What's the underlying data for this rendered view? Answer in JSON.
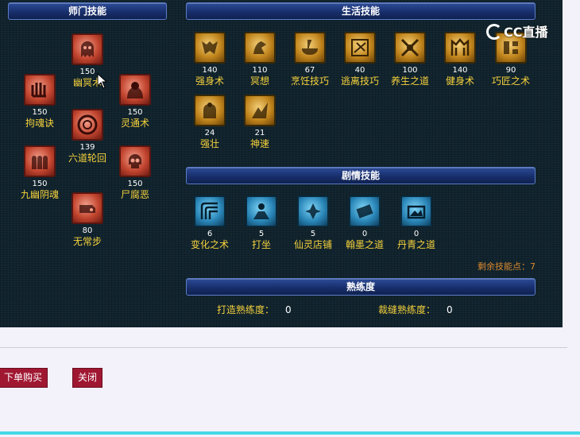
{
  "headers": {
    "sect": "师门技能",
    "life": "生活技能",
    "story": "剧情技能",
    "prof": "熟练度"
  },
  "sect_skills": [
    {
      "name": "幽冥术",
      "level": "150",
      "icon": "ghost-icon"
    },
    {
      "name": "拘魂诀",
      "level": "150",
      "icon": "claw-icon"
    },
    {
      "name": "灵通术",
      "level": "150",
      "icon": "spirit-icon"
    },
    {
      "name": "六道轮回",
      "level": "139",
      "icon": "wheel-icon"
    },
    {
      "name": "九幽阴魂",
      "level": "150",
      "icon": "souls-icon"
    },
    {
      "name": "尸腐恶",
      "level": "150",
      "icon": "skull-icon"
    },
    {
      "name": "无常步",
      "level": "80",
      "icon": "step-icon"
    }
  ],
  "life_skills": [
    {
      "name": "强身术",
      "level": "140",
      "icon": "armor-icon"
    },
    {
      "name": "冥想",
      "level": "110",
      "icon": "meditate-icon"
    },
    {
      "name": "烹饪技巧",
      "level": "67",
      "icon": "cooking-icon"
    },
    {
      "name": "逃离技巧",
      "level": "40",
      "icon": "escape-icon"
    },
    {
      "name": "养生之道",
      "level": "100",
      "icon": "health-icon"
    },
    {
      "name": "健身术",
      "level": "140",
      "icon": "fitness-icon"
    },
    {
      "name": "巧匠之术",
      "level": "90",
      "icon": "craft-icon"
    },
    {
      "name": "强壮",
      "level": "24",
      "icon": "strong-icon"
    },
    {
      "name": "神速",
      "level": "21",
      "icon": "speed-icon"
    }
  ],
  "story_skills": [
    {
      "name": "变化之术",
      "level": "6",
      "icon": "transform-icon"
    },
    {
      "name": "打坐",
      "level": "5",
      "icon": "sit-icon"
    },
    {
      "name": "仙灵店铺",
      "level": "5",
      "icon": "shop-icon"
    },
    {
      "name": "翰墨之道",
      "level": "0",
      "icon": "ink-icon"
    },
    {
      "name": "丹青之道",
      "level": "0",
      "icon": "painting-icon"
    }
  ],
  "remaining_points": "剩余技能点：7",
  "proficiency": {
    "forge_label": "打造熟练度：",
    "forge_value": "0",
    "tailor_label": "裁缝熟练度：",
    "tailor_value": "0"
  },
  "watermark": "CC直播",
  "buttons": {
    "buy": "下单购买",
    "close": "关闭"
  },
  "colors": {
    "panel_bg": "#10232d",
    "header_bg": "#1c3477",
    "name_text": "#f6d23c",
    "remain_text": "#d9892e",
    "button_bg": "#a01732",
    "accent_bar": "#45d8e6"
  }
}
